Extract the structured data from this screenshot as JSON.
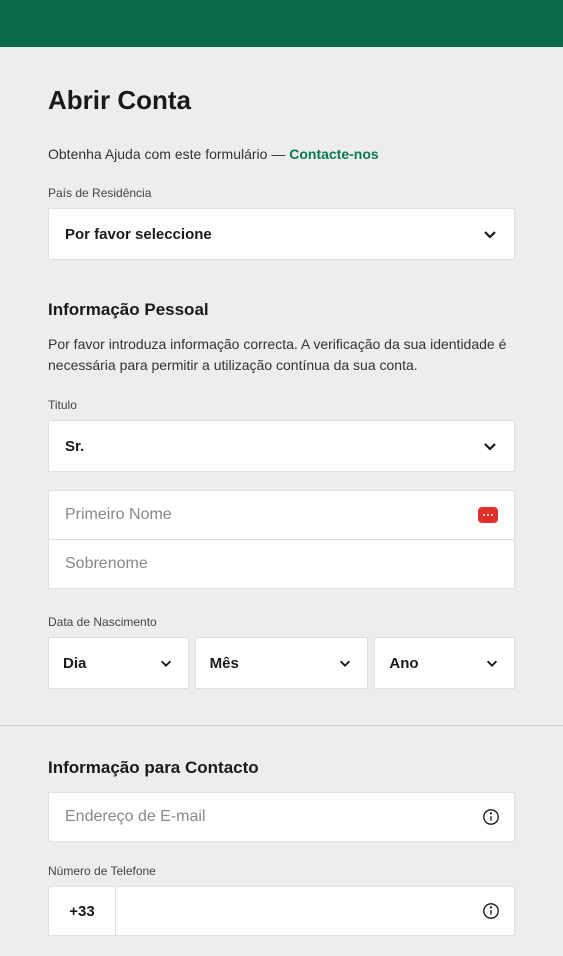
{
  "page": {
    "title": "Abrir Conta",
    "help_prefix": "Obtenha Ajuda com este formulário — ",
    "help_link": "Contacte-nos"
  },
  "country": {
    "label": "País de Residência",
    "value": "Por favor seleccione"
  },
  "personal": {
    "heading": "Informação Pessoal",
    "desc": "Por favor introduza informação correcta. A verificação da sua identidade é necessária para permitir a utilização contínua da sua conta.",
    "title_label": "Titulo",
    "title_value": "Sr.",
    "first_name_placeholder": "Primeiro Nome",
    "last_name_placeholder": "Sobrenome",
    "dob_label": "Data de Nascimento",
    "dob_day": "Dia",
    "dob_month": "Mês",
    "dob_year": "Ano"
  },
  "contact": {
    "heading": "Informação para Contacto",
    "email_placeholder": "Endereço de E-mail",
    "phone_label": "Número de Telefone",
    "phone_code": "+33"
  }
}
